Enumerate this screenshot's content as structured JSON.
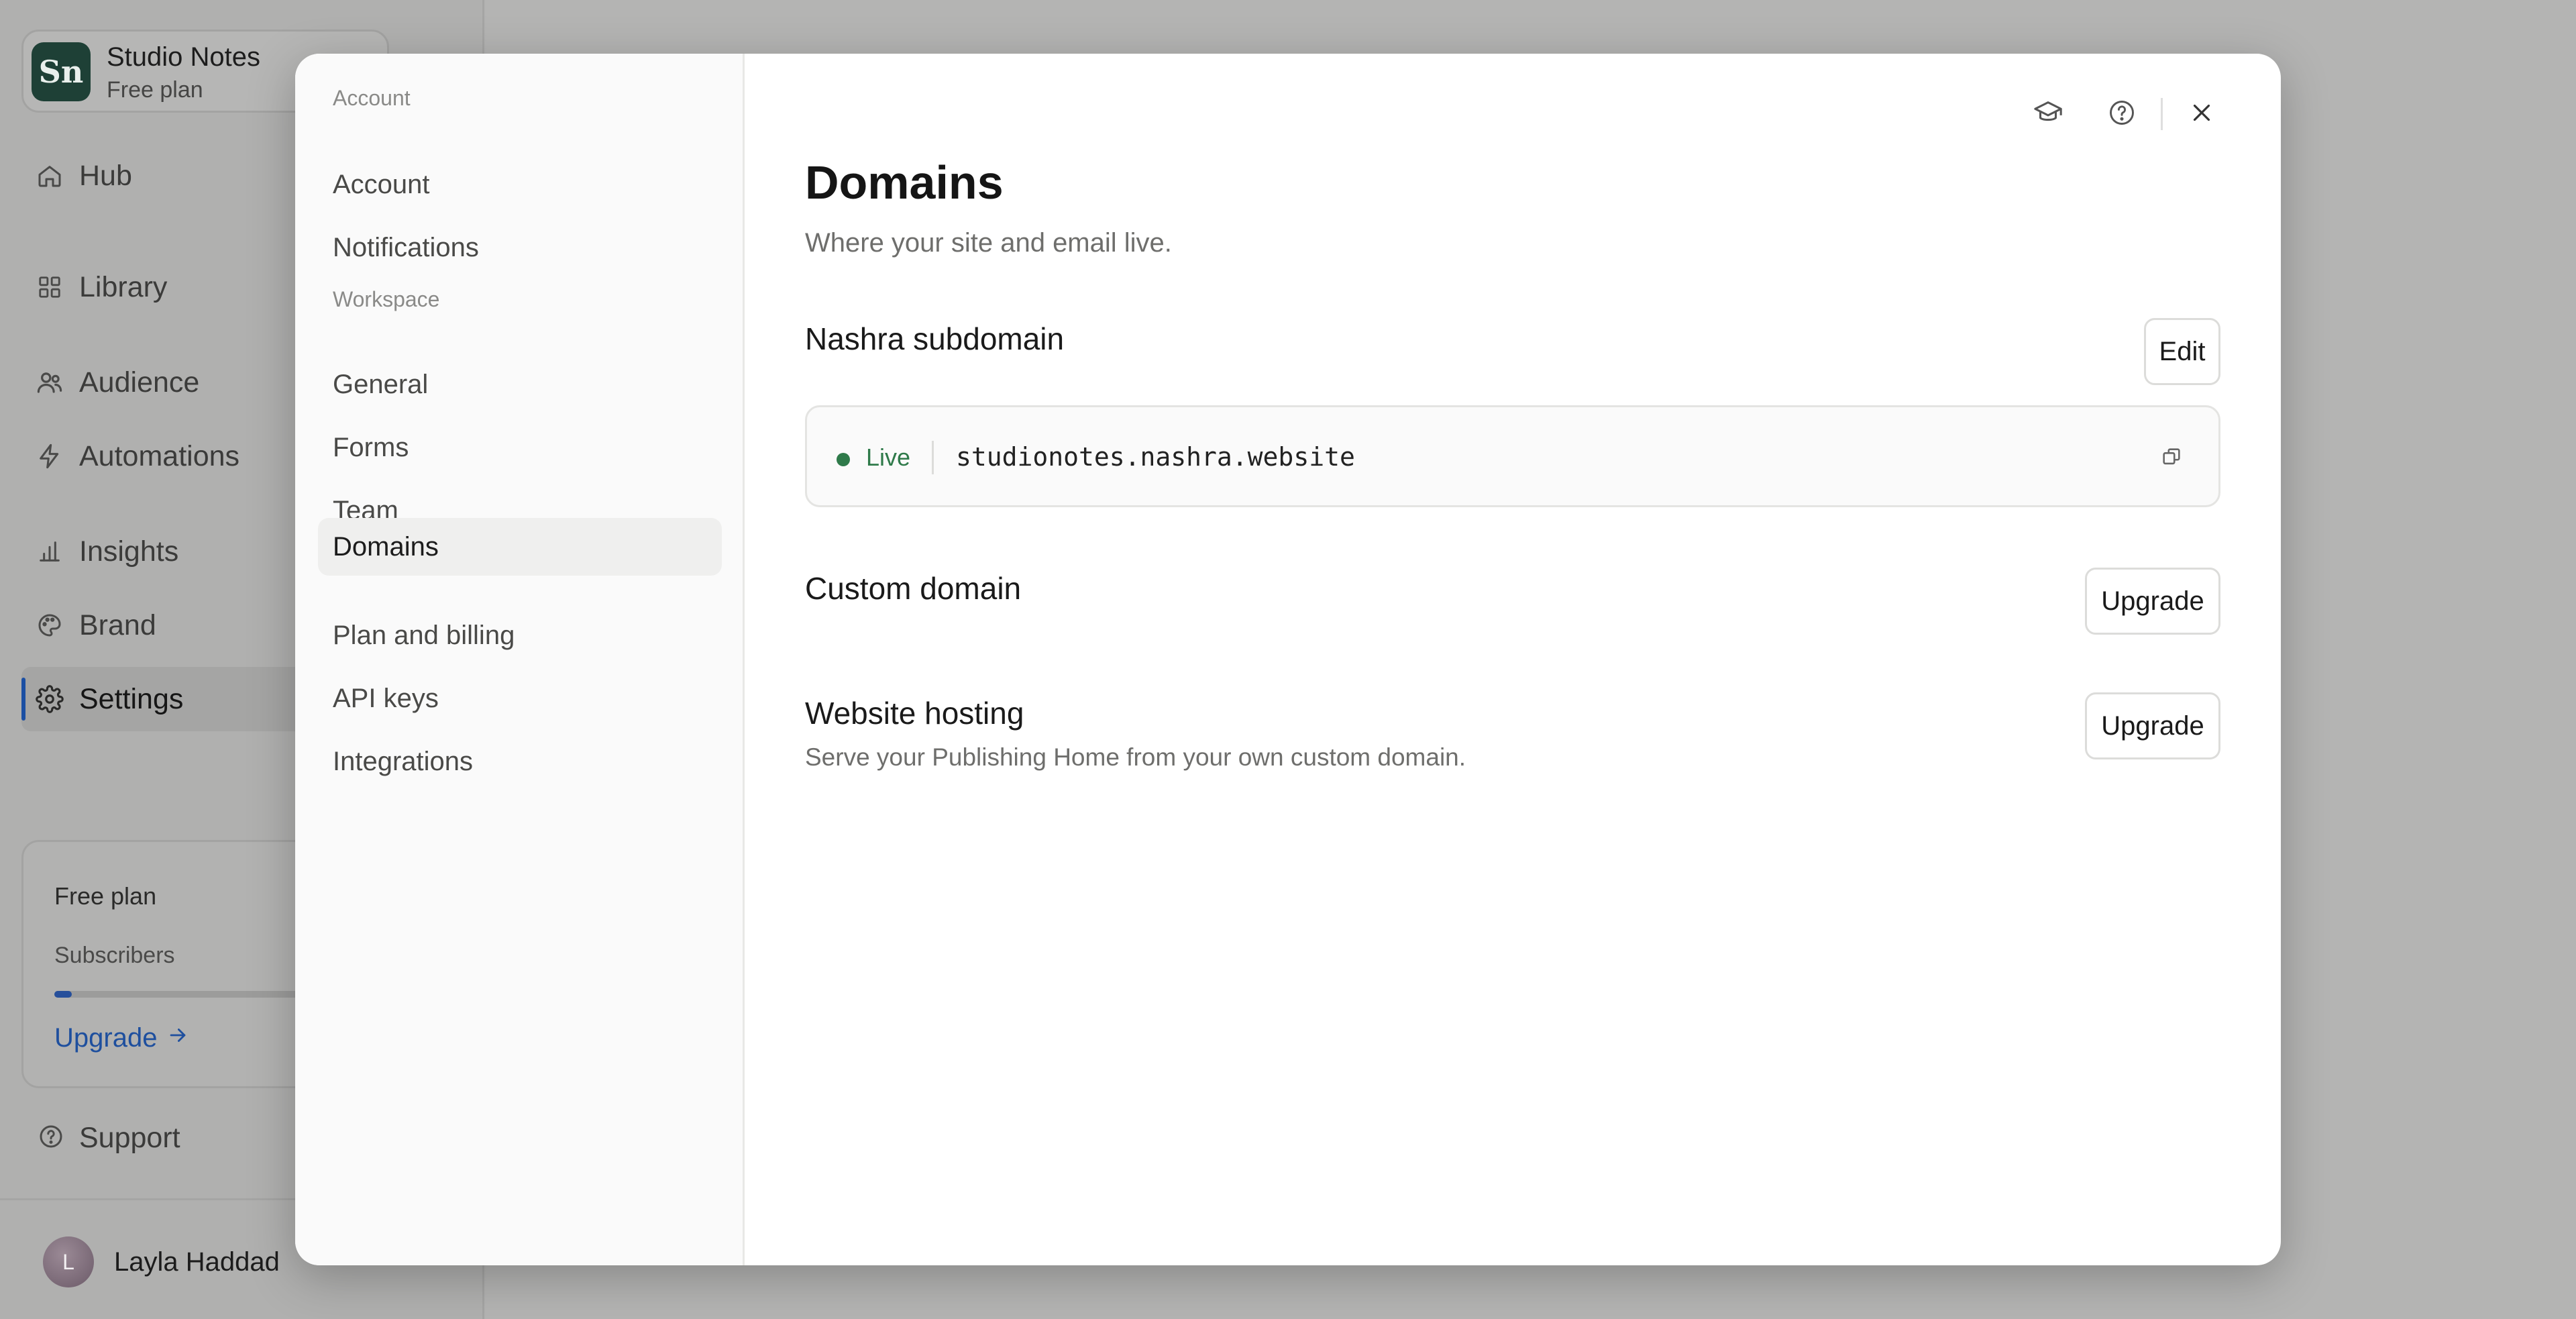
{
  "workspace": {
    "logo_text": "Sn",
    "name": "Studio Notes",
    "plan": "Free plan"
  },
  "sidebar": {
    "items": [
      {
        "label": "Hub",
        "icon": "home-icon"
      },
      {
        "label": "Library",
        "icon": "grid-icon"
      },
      {
        "label": "Audience",
        "icon": "users-icon"
      },
      {
        "label": "Automations",
        "icon": "lightning-icon"
      },
      {
        "label": "Insights",
        "icon": "bar-chart-icon"
      },
      {
        "label": "Brand",
        "icon": "palette-icon"
      },
      {
        "label": "Settings",
        "icon": "gear-icon",
        "active": true
      }
    ],
    "plan_card": {
      "title": "Free plan",
      "metric_label": "Subscribers",
      "usage_fraction": 0.04,
      "upgrade_label": "Upgrade"
    },
    "support_label": "Support",
    "user": {
      "initial": "L",
      "name": "Layla Haddad"
    }
  },
  "settings_nav": {
    "groups": [
      {
        "label": "Account",
        "items": [
          "Account",
          "Notifications"
        ]
      },
      {
        "label": "Workspace",
        "items": [
          "General",
          "Forms",
          "Team",
          "Domains",
          "Plan and billing",
          "API keys",
          "Integrations"
        ]
      }
    ],
    "active_item": "Domains"
  },
  "page": {
    "title": "Domains",
    "subtitle": "Where your site and email live.",
    "subdomain": {
      "title": "Nashra subdomain",
      "edit_label": "Edit",
      "status": "Live",
      "status_color": "#2f7a4a",
      "domain": "studionotes.nashra.website"
    },
    "custom_domain": {
      "title": "Custom domain",
      "button_label": "Upgrade"
    },
    "website_hosting": {
      "title": "Website hosting",
      "description": "Serve your Publishing Home from your own custom domain.",
      "button_label": "Upgrade"
    }
  },
  "colors": {
    "accent": "#1b4fa3",
    "workspace_logo": "#1e4036",
    "live": "#2f7a4a"
  }
}
